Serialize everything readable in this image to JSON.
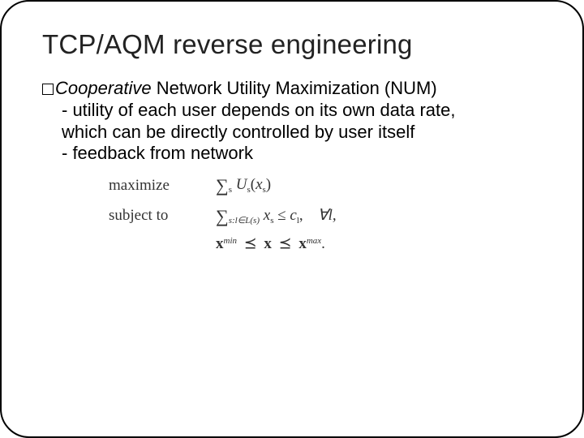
{
  "slide": {
    "title": "TCP/AQM reverse engineering",
    "line1_cooperative": "Cooperative",
    "line1_rest": " Network Utility Maximization (NUM)",
    "line2": "- utility of each user depends on its own data rate,",
    "line3": "which can be directly controlled by user itself",
    "line4": "- feedback from network",
    "math": {
      "maximize_label": "maximize",
      "maximize_expr_sub": "s",
      "maximize_expr_U": "U",
      "maximize_expr_paren_open": "(",
      "maximize_expr_x": "x",
      "maximize_expr_paren_close": ")",
      "subject_label": "subject to",
      "subject_sum_sub": "s:l∈L(s)",
      "subject_x": "x",
      "subject_xsub": "s",
      "subject_le": " ≤ ",
      "subject_c": "c",
      "subject_csub": "l",
      "subject_comma": ",",
      "subject_forall": "∀l,",
      "bounds_xmin_sup": "min",
      "bounds_prec1": "⪯",
      "bounds_x": "x",
      "bounds_prec2": "⪯",
      "bounds_xmax_sup": "max",
      "bounds_period": "."
    }
  }
}
